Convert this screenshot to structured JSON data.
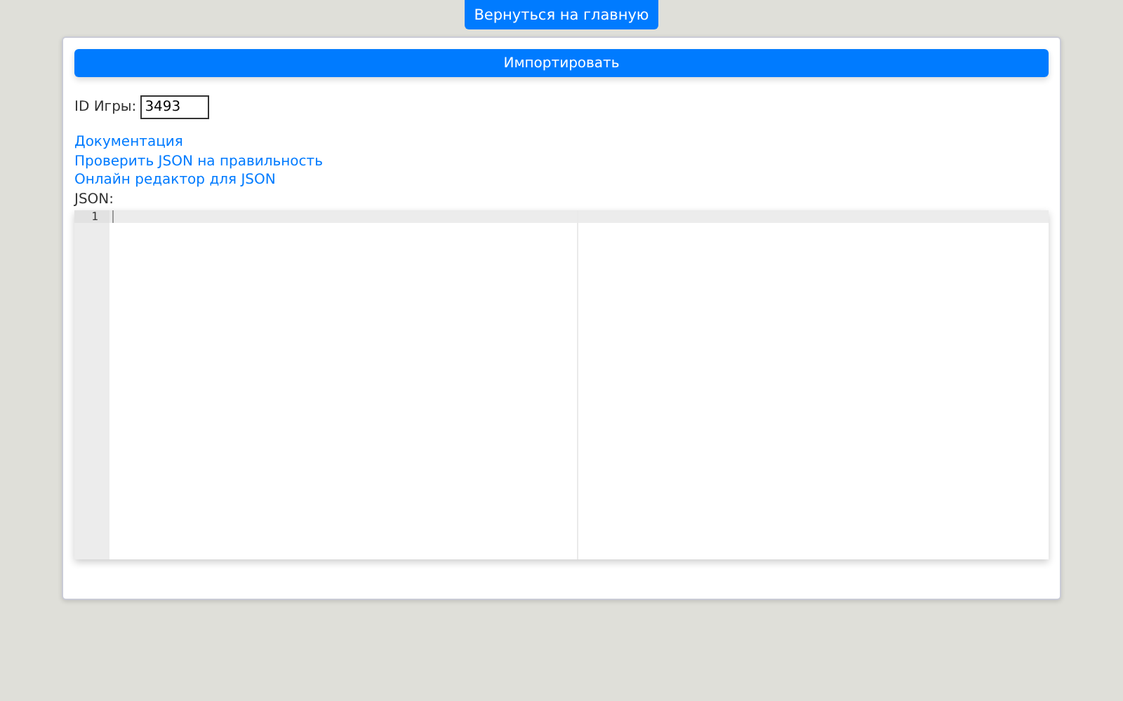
{
  "home_button": {
    "label": "Вернуться на главную"
  },
  "import_button": {
    "label": "Импортировать"
  },
  "game_id": {
    "label": "ID Игры:",
    "value": "3493"
  },
  "links": [
    {
      "label": "Документация"
    },
    {
      "label": "Проверить JSON на правильность"
    },
    {
      "label": "Онлайн редактор для JSON"
    }
  ],
  "editor": {
    "label": "JSON:",
    "line_numbers": [
      "1"
    ]
  }
}
